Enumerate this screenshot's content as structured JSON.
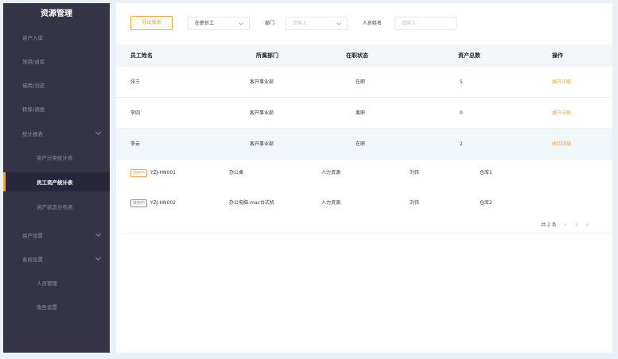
{
  "sidebar": {
    "title": "资源管理",
    "items": [
      {
        "label": "资产入库"
      },
      {
        "label": "领用/退库"
      },
      {
        "label": "借用/归还"
      },
      {
        "label": "转移/调拨"
      },
      {
        "label": "统计报表"
      },
      {
        "label": "资产分类统计表"
      },
      {
        "label": "员工资产统计表"
      },
      {
        "label": "资产状态分布表"
      },
      {
        "label": "资产设置"
      },
      {
        "label": "系统设置"
      },
      {
        "label": "人员管理"
      },
      {
        "label": "角色设置"
      }
    ]
  },
  "filters": {
    "export_label": "导出报表",
    "status_select": "在职员工",
    "dept_label": "部门",
    "dept_placeholder": "请输入",
    "name_label": "人员姓名",
    "name_placeholder": "请输入"
  },
  "table": {
    "headers": [
      "员工姓名",
      "所属部门",
      "在职状态",
      "资产总数",
      "操作"
    ],
    "rows": [
      {
        "name": "张三",
        "dept": "客开事业部",
        "status": "在职",
        "total": "5",
        "action": "展开详细"
      },
      {
        "name": "李四",
        "dept": "客开事业部",
        "status": "离职",
        "total": "0",
        "action": "展开详细"
      },
      {
        "name": "李云",
        "dept": "客开事业部",
        "status": "在职",
        "total": "2",
        "action": "收回详细"
      }
    ],
    "detail_rows": [
      {
        "tag": "借用中",
        "code": "YZJ-HN001",
        "item": "办公桌",
        "dept": "人力资源",
        "person": "刘伟",
        "location": "仓库1"
      },
      {
        "tag": "使用中",
        "code": "YZJ-HN002",
        "item": "办公电脑-mac台式机",
        "dept": "人力资源",
        "person": "刘伟",
        "location": "仓库2"
      }
    ]
  },
  "pagination": {
    "total_text": "共 2 条",
    "current_page": "1",
    "prev": "‹",
    "next": "›"
  },
  "colors": {
    "accent": "#f0a83b",
    "sidebar_bg": "#353447",
    "sidebar_active": "#27263a",
    "highlight_row": "#f1f6fb"
  }
}
